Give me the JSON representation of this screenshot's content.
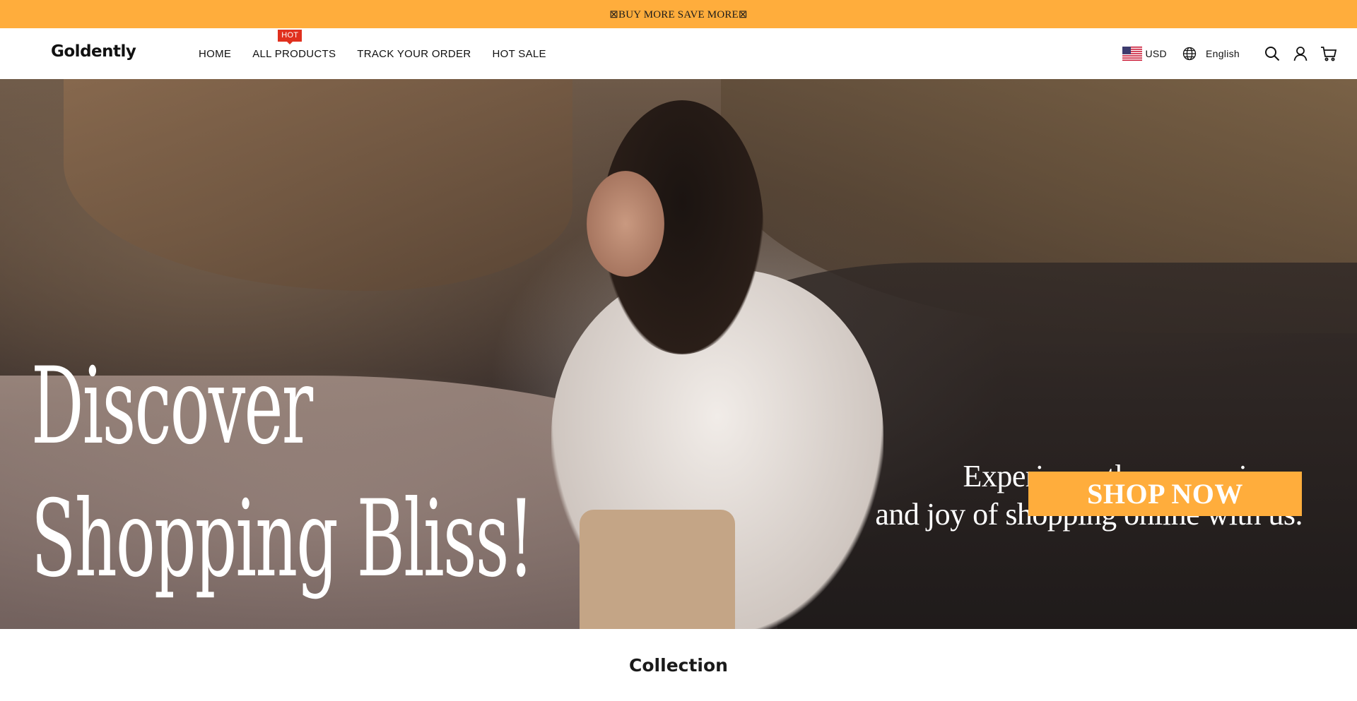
{
  "announcement": {
    "text": "⊠BUY MORE SAVE MORE⊠"
  },
  "header": {
    "logo": "Goldently",
    "nav": [
      {
        "label": "HOME"
      },
      {
        "label": "ALL PRODUCTS",
        "badge": "HOT"
      },
      {
        "label": "TRACK YOUR ORDER"
      },
      {
        "label": "HOT SALE"
      }
    ],
    "currency": {
      "label": "USD",
      "flag_icon": "us-flag-icon"
    },
    "language": {
      "label": "English",
      "icon": "globe-icon"
    },
    "icons": [
      "search-icon",
      "account-icon",
      "cart-icon"
    ]
  },
  "hero": {
    "headline_line1": "Discover",
    "headline_line2": "Shopping Bliss!",
    "tagline_line1": "Experience the convenience",
    "tagline_line2": "and joy of shopping online with us.",
    "cta_label": "SHOP NOW"
  },
  "collection": {
    "title": "Collection"
  },
  "colors": {
    "accent": "#ffad3c",
    "hot_badge": "#e0301e",
    "text_dark": "#111111",
    "white": "#ffffff"
  }
}
